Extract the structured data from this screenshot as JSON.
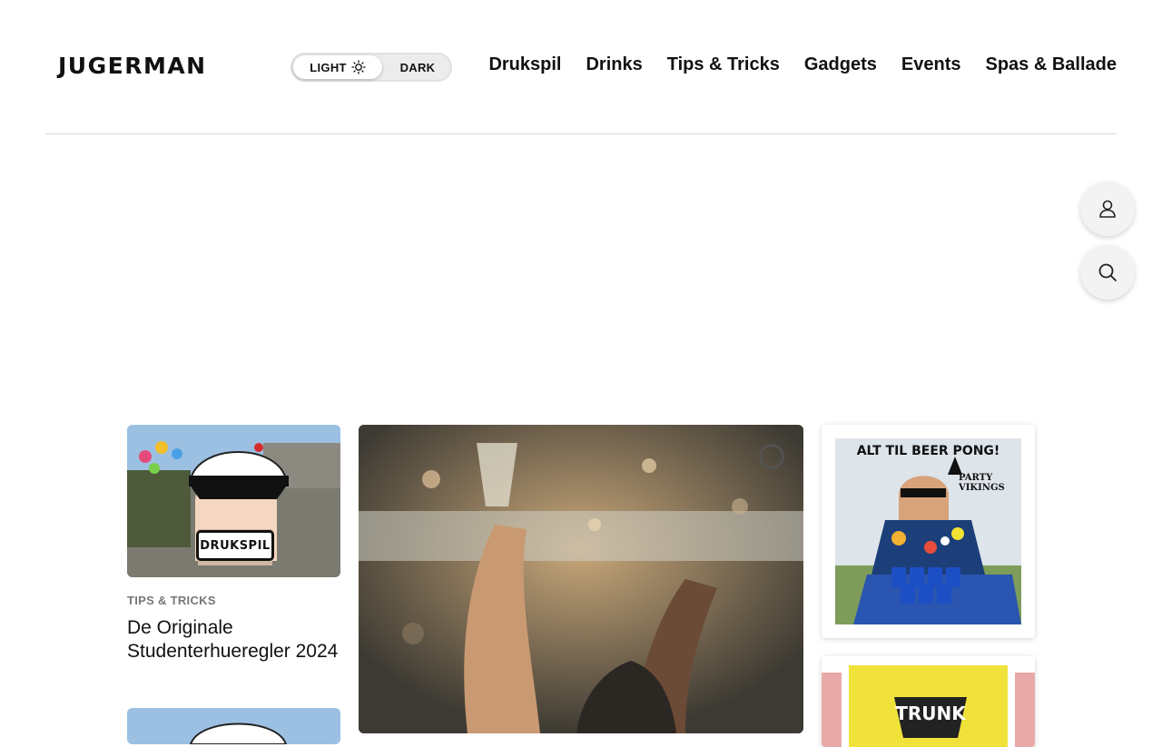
{
  "brand": {
    "logo_text": "JUGERMAN"
  },
  "theme_toggle": {
    "light_label": "LIGHT",
    "dark_label": "DARK",
    "selected": "LIGHT"
  },
  "nav": {
    "items": [
      "Drukspil",
      "Drinks",
      "Tips & Tricks",
      "Gadgets",
      "Events",
      "Spas & Ballade"
    ]
  },
  "floating_buttons": {
    "user_icon": "user-icon",
    "search_icon": "search-icon"
  },
  "articles": [
    {
      "category": "TIPS & TRICKS",
      "title": "De Originale Studenterhueregler 2024",
      "thumb_label": "DRUKSPIL"
    }
  ],
  "ads": [
    {
      "headline": "ALT TIL BEER PONG!",
      "brand_line1": "PARTY",
      "brand_line2": "VIKINGS"
    },
    {
      "headline": "TRUNK"
    }
  ],
  "colors": {
    "text": "#111111",
    "category": "#777777",
    "divider": "#d8d8d8",
    "cup_blue": "#1d4fc4"
  }
}
